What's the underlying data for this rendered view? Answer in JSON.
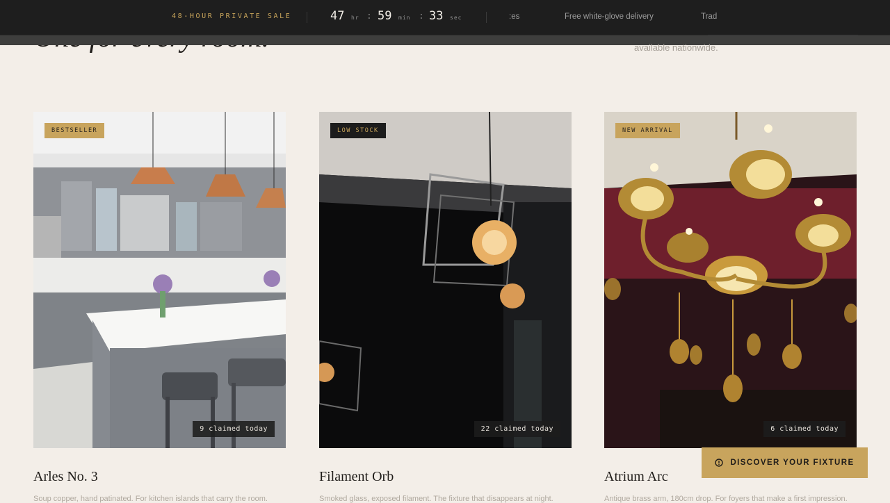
{
  "banner": {
    "sale_label": "48-HOUR PRIVATE SALE",
    "countdown": {
      "hours": "47",
      "hours_unit": "hr",
      "minutes": "59",
      "minutes_unit": "min",
      "seconds": "33",
      "seconds_unit": "sec"
    },
    "marquee": [
      ":es",
      "Free white-glove delivery",
      "Trad"
    ]
  },
  "hero": {
    "heading": "One for every room.",
    "subtext": "available nationwide."
  },
  "products": [
    {
      "badge": "BESTSELLER",
      "claimed": "9 claimed today",
      "title": "Arles No. 3",
      "description": "Soup copper, hand patinated. For kitchen islands that carry the room."
    },
    {
      "badge": "LOW STOCK",
      "claimed": "22 claimed today",
      "title": "Filament Orb",
      "description": "Smoked glass, exposed filament. The fixture that disappears at night."
    },
    {
      "badge": "NEW ARRIVAL",
      "claimed": "6 claimed today",
      "title": "Atrium Arc",
      "description": "Antique brass arm, 180cm drop. For foyers that make a first impression."
    }
  ],
  "cta": {
    "label": "DISCOVER YOUR FIXTURE",
    "icon": "info-circle-icon"
  },
  "colors": {
    "gold": "#c8a45d",
    "banner": "#1e1e1e",
    "background": "#f3eee8"
  }
}
